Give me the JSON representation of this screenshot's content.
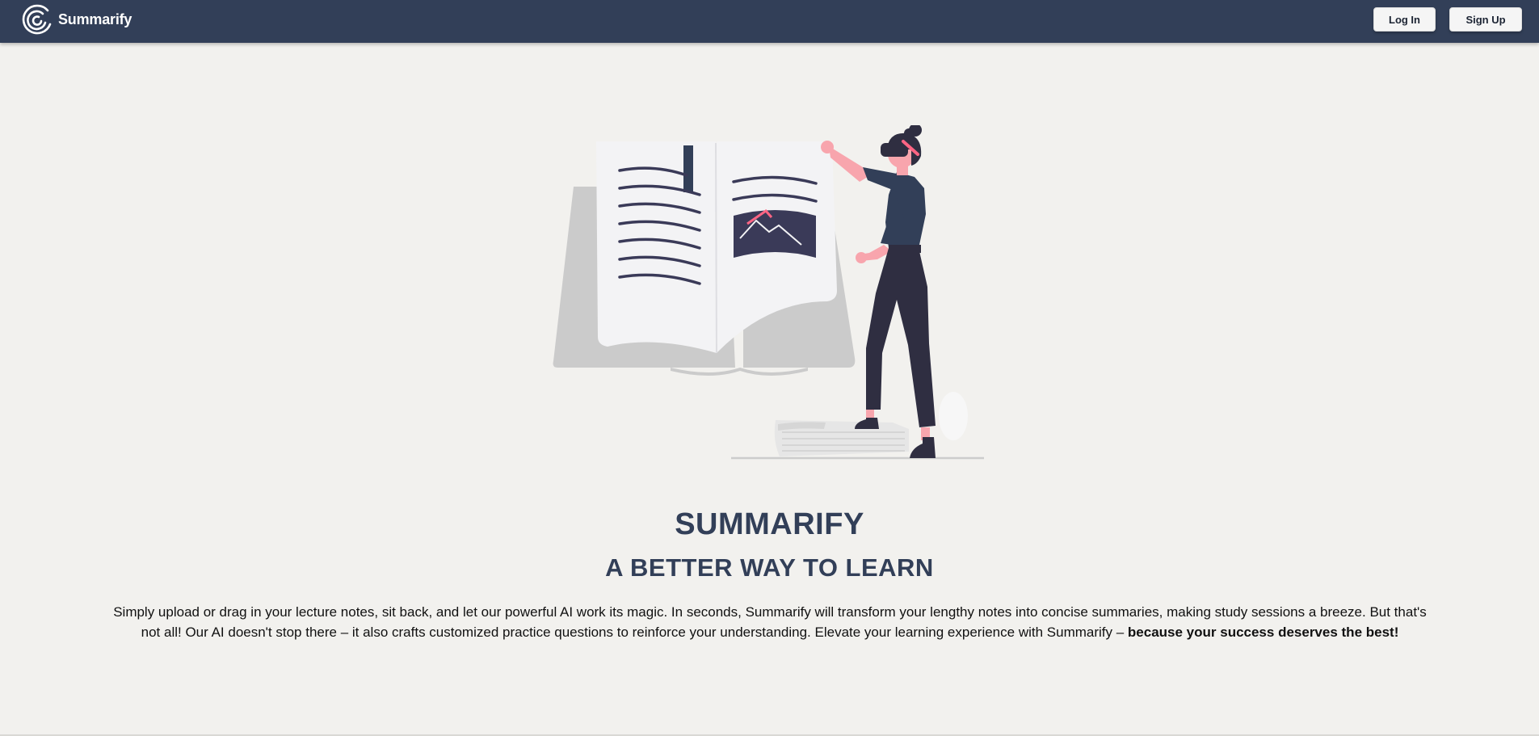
{
  "navbar": {
    "brand_name": "Summarify",
    "login_label": "Log In",
    "signup_label": "Sign Up",
    "background_color": "#323f58"
  },
  "hero": {
    "illustration_icon": "reading-book-illustration",
    "title": "SUMMARIFY",
    "subtitle_prefix": "A BETTER WAY TO ",
    "subtitle_emphasis": "LEARN",
    "description": "Simply upload or drag in your lecture notes, sit back, and let our powerful AI work its magic. In seconds, Summarify will transform your lengthy notes into concise summaries, making study sessions a breeze. But that's not all! Our AI doesn't stop there – it also crafts customized practice questions to reinforce your understanding. Elevate your learning experience with Summarify – ",
    "description_emphasis": "because your success deserves the best!"
  },
  "colors": {
    "accent": "#323f58",
    "page_background": "#f2f1ee",
    "illustration_pink": "#f8a5ad"
  }
}
